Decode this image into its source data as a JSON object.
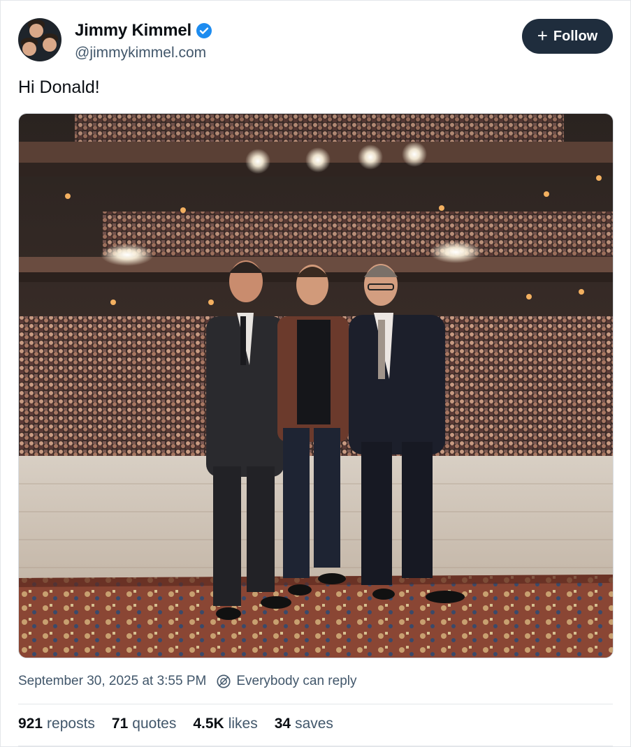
{
  "author": {
    "display_name": "Jimmy Kimmel",
    "handle": "@jimmykimmel.com",
    "verified": true,
    "avatar_icon": "group-photo-avatar"
  },
  "follow_button": {
    "icon": "plus-icon",
    "label": "Follow"
  },
  "post": {
    "text": "Hi Donald!",
    "image_icon": "stage-photo-three-men-theater-audience"
  },
  "meta": {
    "timestamp": "September 30, 2025 at 3:55 PM",
    "reply_setting_icon": "reply-restriction-icon",
    "reply_setting": "Everybody can reply"
  },
  "stats": {
    "reposts": {
      "count": "921",
      "label": "reposts"
    },
    "quotes": {
      "count": "71",
      "label": "quotes"
    },
    "likes": {
      "count": "4.5K",
      "label": "likes"
    },
    "saves": {
      "count": "34",
      "label": "saves"
    }
  },
  "colors": {
    "follow_bg": "#1f2d3d",
    "verified": "#1d8cf0",
    "secondary_text": "#42576b"
  }
}
